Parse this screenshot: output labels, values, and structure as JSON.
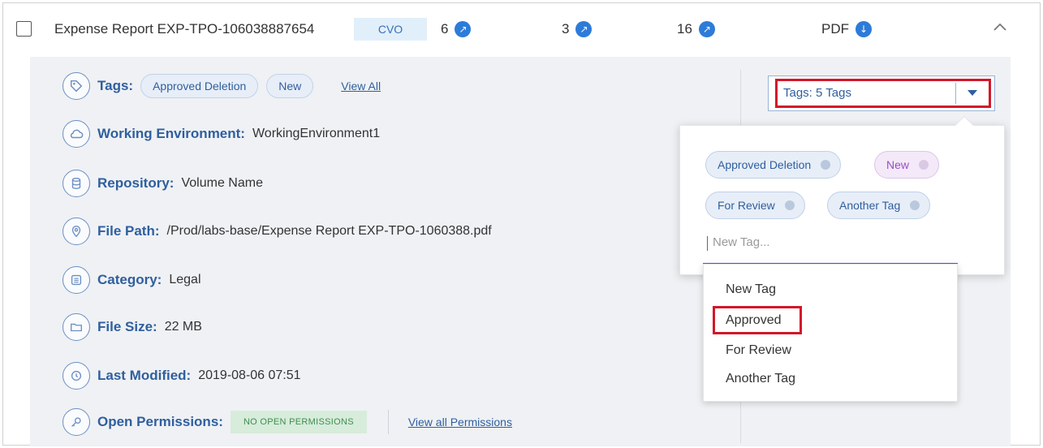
{
  "header": {
    "title": "Expense Report EXP-TPO-106038887654",
    "type_badge": "CVO",
    "counts": [
      {
        "value": "6"
      },
      {
        "value": "3"
      },
      {
        "value": "16"
      }
    ],
    "file_type": "PDF"
  },
  "details": {
    "tags": {
      "label": "Tags:",
      "items": [
        "Approved Deletion",
        "New"
      ],
      "view_all": "View All"
    },
    "working_environment": {
      "label": "Working Environment:",
      "value": "WorkingEnvironment1"
    },
    "repository": {
      "label": "Repository:",
      "value": "Volume Name"
    },
    "file_path": {
      "label": "File Path:",
      "value": "/Prod/labs-base/Expense Report EXP-TPO-1060388.pdf"
    },
    "category": {
      "label": "Category:",
      "value": "Legal"
    },
    "file_size": {
      "label": "File Size:",
      "value": "22 MB"
    },
    "last_modified": {
      "label": "Last Modified:",
      "value": "2019-08-06 07:51"
    },
    "open_permissions": {
      "label": "Open Permissions:",
      "badge": "NO OPEN PERMISSIONS",
      "link": "View all Permissions"
    }
  },
  "tags_dropdown": {
    "label": "Tags: 5 Tags",
    "selected_tags": [
      "Approved Deletion",
      "New",
      "For Review",
      "Another Tag"
    ],
    "input_placeholder": "New Tag...",
    "options": [
      "New Tag",
      "Approved",
      "For Review",
      "Another Tag"
    ]
  },
  "colors": {
    "accent": "#2d7bd9",
    "label_blue": "#2f5f9e",
    "highlight_red": "#d3172a",
    "panel_bg": "#eff1f4",
    "permission_green": "#3f8e4e"
  }
}
